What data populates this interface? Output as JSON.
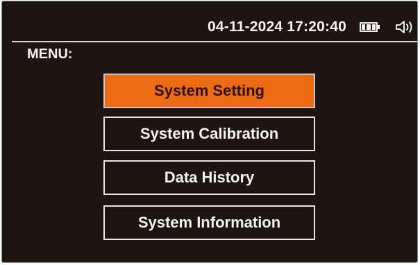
{
  "status_bar": {
    "datetime": "04-11-2024 17:20:40",
    "battery_icon": "battery-icon",
    "speaker_icon": "speaker-volume-icon"
  },
  "menu": {
    "title": "MENU:",
    "items": [
      {
        "label": "System Setting",
        "selected": true
      },
      {
        "label": "System Calibration",
        "selected": false
      },
      {
        "label": "Data History",
        "selected": false
      },
      {
        "label": "System Information",
        "selected": false
      }
    ]
  },
  "colors": {
    "background": "#1e1513",
    "selected_item": "#ee6b16",
    "border": "#e6e6e6",
    "text": "#f4f4f4"
  }
}
